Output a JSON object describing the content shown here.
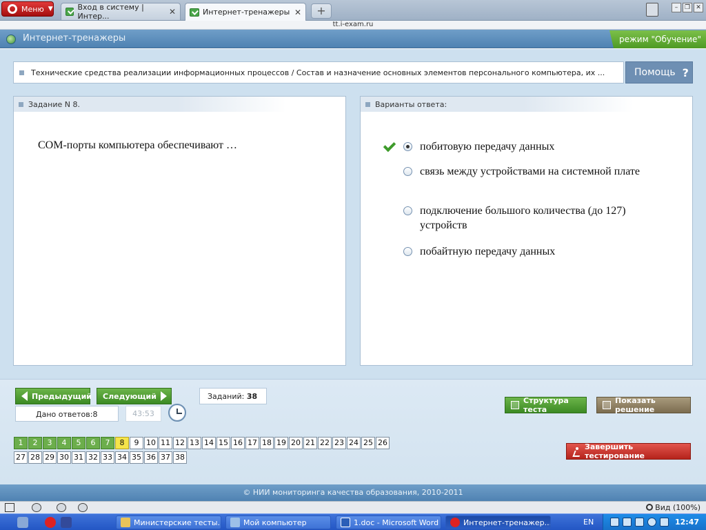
{
  "browser": {
    "menu_label": "Меню",
    "tabs": [
      {
        "label": "Вход в систему | Интер..."
      },
      {
        "label": "Интернет-тренажеры"
      }
    ],
    "url": "tt.i-exam.ru"
  },
  "header": {
    "title": "Интернет-тренажеры",
    "mode": "режим \"Обучение\""
  },
  "breadcrumb": "Технические средства реализации информационных процессов / Состав и назначение основных элементов персонального компьютера, их ...",
  "help_label": "Помощь",
  "task": {
    "header": "Задание N 8.",
    "question": "COM-порты компьютера обеспечивают …"
  },
  "answers": {
    "header": "Варианты ответа:",
    "options": [
      {
        "text": "побитовую передачу данных",
        "selected": true,
        "correct": true
      },
      {
        "text": "связь между устройствами на системной плате",
        "selected": false
      },
      {
        "text": "подключение большого количества (до 127) устройств",
        "selected": false
      },
      {
        "text": "побайтную передачу данных",
        "selected": false
      }
    ]
  },
  "controls": {
    "prev_label": "Предыдущий",
    "next_label": "Следующий",
    "answered_label": "Дано ответов:",
    "answered_count": "8",
    "timer": "43:53",
    "tasks_label": "Заданий:",
    "tasks_count": "38",
    "structure_label": "Структура теста",
    "solution_label": "Показать решение",
    "finish_label": "Завершить тестирование"
  },
  "question_grid": {
    "row1": [
      "1",
      "2",
      "3",
      "4",
      "5",
      "6",
      "7",
      "8",
      "9",
      "10",
      "11",
      "12",
      "13",
      "14",
      "15",
      "16",
      "17",
      "18",
      "19",
      "20",
      "21",
      "22",
      "23",
      "24",
      "25",
      "26"
    ],
    "row2": [
      "27",
      "28",
      "29",
      "30",
      "31",
      "32",
      "33",
      "34",
      "35",
      "36",
      "37",
      "38"
    ],
    "answered": 7,
    "current": 8
  },
  "footer": "© НИИ мониторинга качества образования, 2010-2011",
  "statusbar": {
    "zoom": "Вид (100%)"
  },
  "taskbar": {
    "items": [
      {
        "label": "Министерские тесты..."
      },
      {
        "label": "Мой компьютер"
      },
      {
        "label": "1.doc - Microsoft Word"
      },
      {
        "label": "Интернет-тренажер..."
      }
    ],
    "lang": "EN",
    "clock": "12:47"
  },
  "colors": {
    "accent_blue": "#5b8bba",
    "done_green": "#6cae4c",
    "current_yellow": "#f5e44a",
    "finish_red": "#c8342b"
  }
}
